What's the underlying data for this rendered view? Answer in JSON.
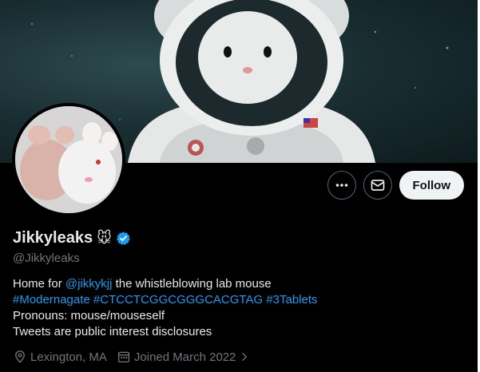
{
  "profile": {
    "display_name": "Jikkyleaks",
    "name_emoji": "🐭",
    "handle": "@Jikkyleaks"
  },
  "actions": {
    "more_icon": "more-dots-icon",
    "message_icon": "envelope-icon",
    "follow_label": "Follow"
  },
  "bio": {
    "line1_prefix": "Home for ",
    "line1_mention": "@jikkykjj",
    "line1_suffix": " the whistleblowing lab mouse",
    "hashtags": [
      "#Modernagate",
      "#CTCCTCGGCGGGCACGTAG",
      "#3Tablets"
    ],
    "line3": "Pronouns: mouse/mouseself",
    "line4": "Tweets are public interest disclosures"
  },
  "meta": {
    "location": "Lexington, MA",
    "joined": "Joined March 2022"
  },
  "colors": {
    "accent": "#1d9bf0",
    "muted": "#71767b",
    "verified": "#1d9bf0"
  }
}
